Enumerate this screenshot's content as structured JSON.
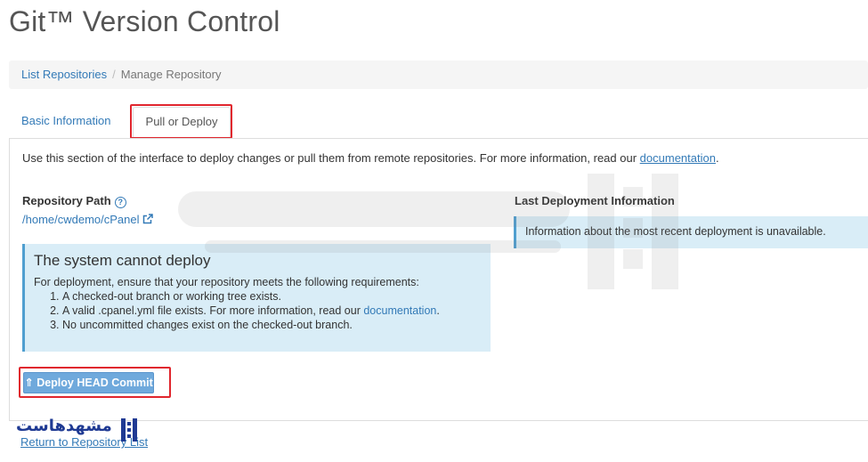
{
  "page": {
    "title": "Git™ Version Control"
  },
  "breadcrumb": {
    "list_label": "List Repositories",
    "separator": "/",
    "current": "Manage Repository"
  },
  "tabs": [
    {
      "label": "Basic Information"
    },
    {
      "label": "Pull or Deploy"
    }
  ],
  "intro": {
    "text": "Use this section of the interface to deploy changes or pull them from remote repositories. For more information, read our ",
    "link": "documentation",
    "suffix": "."
  },
  "repository": {
    "path_label": "Repository Path",
    "path_value": "/home/cwdemo/cPanel"
  },
  "alert": {
    "title": "The system cannot deploy",
    "lead": "For deployment, ensure that your repository meets the following requirements:",
    "req1": "A checked-out branch or working tree exists.",
    "req2_text": "A valid .cpanel.yml file exists. For more information, read our ",
    "req2_link": "documentation",
    "req2_suffix": ".",
    "req3": "No uncommitted changes exist on the checked-out branch."
  },
  "deploy": {
    "button_label": "Deploy HEAD Commit"
  },
  "last_deployment": {
    "label": "Last Deployment Information",
    "info": "Information about the most recent deployment is unavailable."
  },
  "footer": {
    "return_link": "Return to Repository List"
  },
  "brand": {
    "logo_text": "مشهدهاست"
  },
  "colors": {
    "link": "#337ab7",
    "info_bg": "#d9edf7",
    "info_border": "#4f9fd0",
    "button": "#6fa9dc",
    "highlight": "#e0262e"
  }
}
